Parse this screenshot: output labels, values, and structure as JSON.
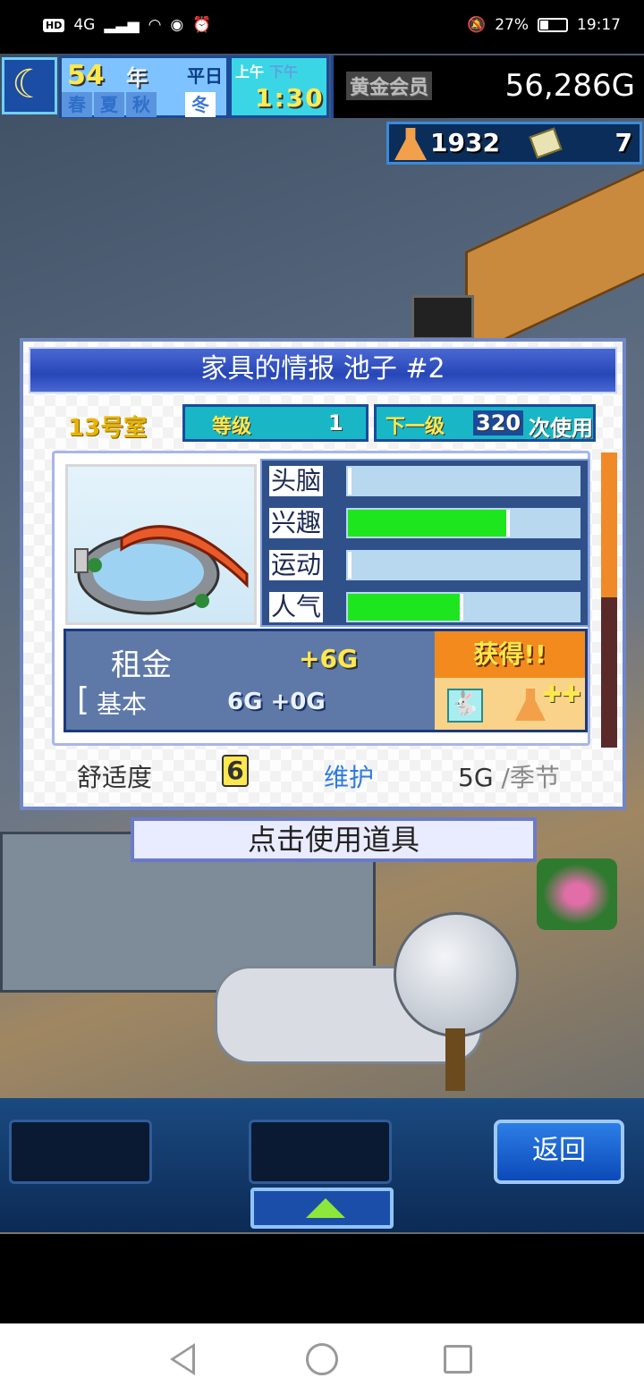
{
  "status_bar": {
    "time": "19:17",
    "battery": "27%",
    "network": "4G"
  },
  "hud": {
    "year": "54",
    "year_label": "年",
    "weekday": "平日",
    "seasons": [
      "春",
      "夏",
      "秋",
      "冬"
    ],
    "current_season": "冬",
    "am": "上午",
    "pm": "下午",
    "clock": "1:30",
    "membership": "黄金会员",
    "gold": "56,286G",
    "research_points": "1932",
    "tickets": "7"
  },
  "dialog": {
    "title": "家具的情报 池子 #2",
    "room": "13号室",
    "level_label": "等级",
    "level_value": "1",
    "next_label": "下一级",
    "next_value": "320",
    "next_unit": "次使用",
    "stats": [
      {
        "label": "头脑",
        "value": 0
      },
      {
        "label": "兴趣",
        "value": 0.7
      },
      {
        "label": "运动",
        "value": 0
      },
      {
        "label": "人气",
        "value": 0.5
      }
    ],
    "rent_label": "租金",
    "rent_value": "+6G",
    "base_label": "基本",
    "base_value": "6G +0G",
    "obtain_label": "获得!!",
    "comfort_label": "舒适度",
    "comfort_value": "6",
    "maintenance_label": "维护",
    "maintenance_cost": "5G",
    "maintenance_unit": "/季节",
    "scroll_position": 0.0
  },
  "use_item_button": "点击使用道具",
  "back_button": "返回",
  "colors": {
    "accent": "#2747b8",
    "stat_fill": "#1ee61e",
    "gold_text": "#ffe84d",
    "obtain_bg": "#f28a1e"
  }
}
